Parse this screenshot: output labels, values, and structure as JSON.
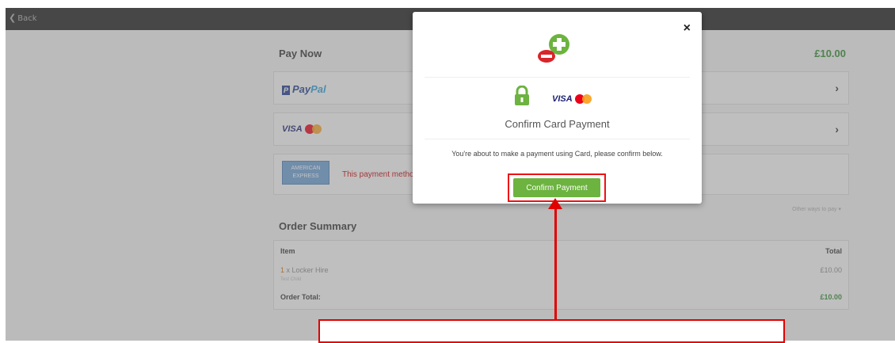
{
  "topbar": {
    "back_label": "Back"
  },
  "pay": {
    "heading": "Pay Now",
    "amount": "£10.00",
    "paypal": {
      "part1": "Pay",
      "part2": "Pal"
    },
    "visa_label": "VISA",
    "amex": {
      "line1": "AMERICAN",
      "line2": "EXPRESS",
      "message": "This payment metho"
    },
    "other_ways": "Other ways to pay ▾"
  },
  "order": {
    "heading": "Order Summary",
    "col_item": "Item",
    "col_total": "Total",
    "item_qty": "1",
    "item_name": "x Locker Hire",
    "item_sub": "Test Child",
    "item_total": "£10.00",
    "total_label": "Order Total:",
    "total_value": "£10.00"
  },
  "modal": {
    "close": "×",
    "visa_label": "VISA",
    "title": "Confirm Card Payment",
    "text": "You're about to make a payment using Card, please confirm below.",
    "confirm_label": "Confirm Payment"
  },
  "colors": {
    "accent_green": "#6cb33f",
    "annotation_red": "#e10000",
    "topbar": "#1f1f1f"
  }
}
